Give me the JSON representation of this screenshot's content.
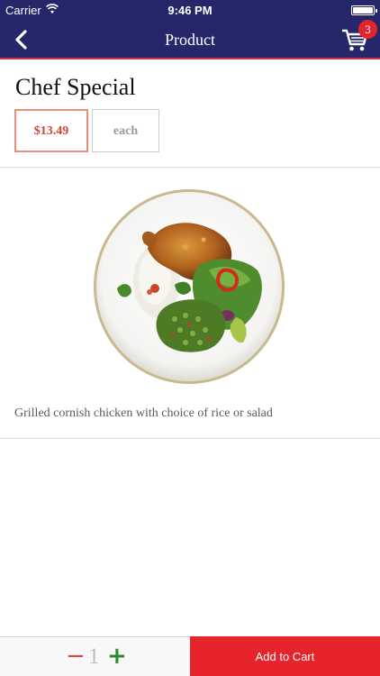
{
  "status_bar": {
    "carrier": "Carrier",
    "time": "9:46 PM",
    "icons": [
      "wifi-icon",
      "battery-icon"
    ]
  },
  "nav": {
    "title": "Product",
    "back_icon": "chevron-left-icon",
    "cart_icon": "cart-icon",
    "cart_count": "3"
  },
  "product": {
    "name": "Chef Special",
    "options": [
      {
        "label": "$13.49",
        "selected": true
      },
      {
        "label": "each",
        "selected": false
      }
    ],
    "description": "Grilled cornish chicken with choice of rice or salad"
  },
  "order": {
    "minus_symbol": "−",
    "quantity": "1",
    "plus_symbol": "+",
    "add_to_cart_label": "Add to Cart"
  },
  "colors": {
    "navbar": "#25276a",
    "accent_red": "#e7232b",
    "price_text": "#d8403a",
    "plus_green": "#2d8a2a"
  }
}
